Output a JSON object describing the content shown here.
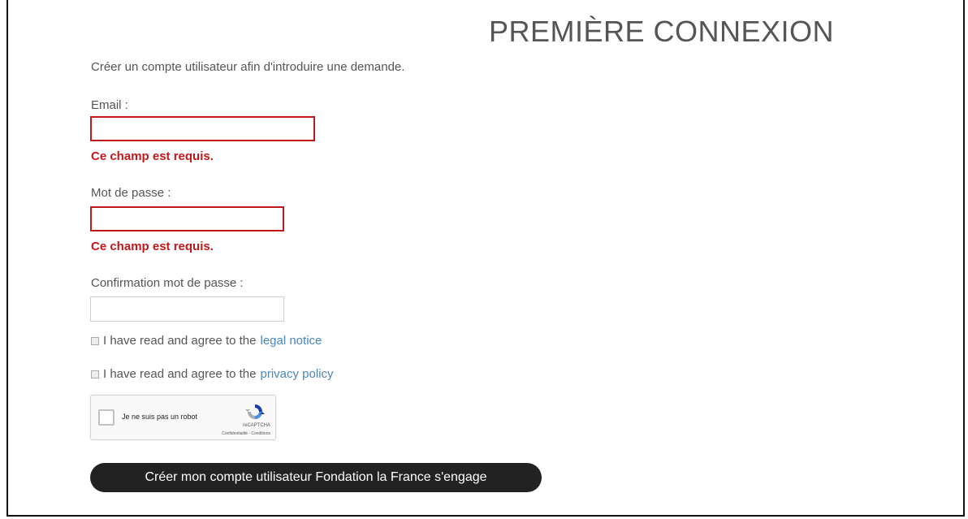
{
  "page": {
    "title": "PREMIÈRE CONNEXION",
    "intro": "Créer un compte utilisateur afin d'introduire une demande."
  },
  "form": {
    "email": {
      "label": "Email :",
      "value": "",
      "placeholder": "",
      "error": "Ce champ est requis."
    },
    "password": {
      "label": "Mot de passe :",
      "value": "",
      "placeholder": "",
      "error": "Ce champ est requis."
    },
    "confirm_password": {
      "label": "Confirmation mot de passe :",
      "value": "",
      "placeholder": ""
    },
    "legal": {
      "text": "I have read and agree to the",
      "link": "legal notice"
    },
    "privacy": {
      "text": "I have read and agree to the",
      "link": "privacy policy"
    },
    "captcha": {
      "label": "Je ne suis pas un robot",
      "brand": "reCAPTCHA",
      "terms": "Confidentialité - Conditions"
    },
    "submit_label": "Créer mon compte utilisateur Fondation la France s'engage"
  },
  "colors": {
    "error": "#c0191b",
    "link": "#4a86b8",
    "button_bg": "#222222"
  },
  "icons": [
    "recaptcha-logo-icon",
    "checkbox-icon"
  ]
}
